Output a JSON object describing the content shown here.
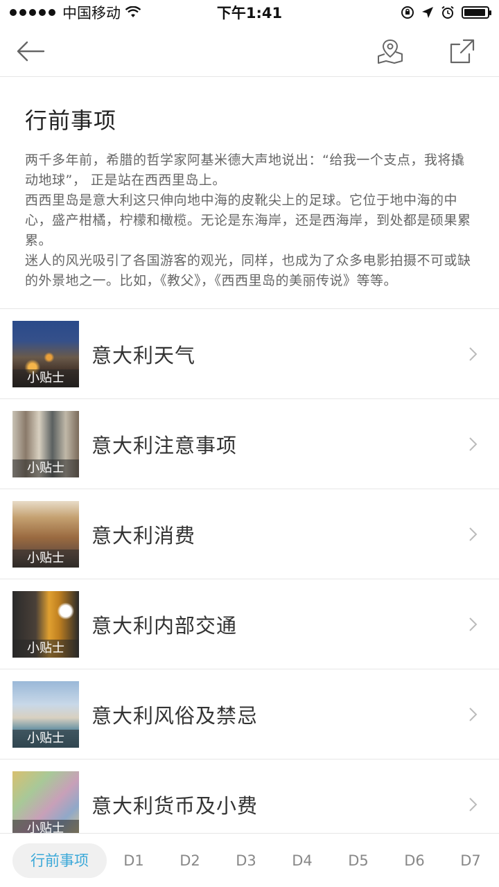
{
  "status_bar": {
    "carrier": "中国移动",
    "time": "下午1:41",
    "battery_level": 0.95
  },
  "nav": {
    "back_icon": "arrow-left-icon",
    "map_icon": "map-pin-icon",
    "share_icon": "share-icon"
  },
  "intro": {
    "title": "行前事项",
    "paragraphs": [
      "两千多年前，希腊的哲学家阿基米德大声地说出：“给我一个支点，我将撬动地球”， 正是站在西西里岛上。",
      "西西里岛是意大利这只伸向地中海的皮靴尖上的足球。它位于地中海的中心，盛产柑橘，柠檬和橄榄。无论是东海岸，还是西海岸，到处都是硕果累累。",
      "迷人的风光吸引了各国游客的观光，同样，也成为了众多电影拍摄不可或缺的外景地之一。比如，《教父》，《西西里岛的美丽传说》等等。"
    ]
  },
  "list": {
    "items": [
      {
        "tag": "小贴士",
        "label": "意大利天气"
      },
      {
        "tag": "小贴士",
        "label": "意大利注意事项"
      },
      {
        "tag": "小贴士",
        "label": "意大利消费"
      },
      {
        "tag": "小贴士",
        "label": "意大利内部交通"
      },
      {
        "tag": "小贴士",
        "label": "意大利风俗及禁忌"
      },
      {
        "tag": "小贴士",
        "label": "意大利货币及小费"
      }
    ]
  },
  "tabs": {
    "items": [
      {
        "label": "行前事项"
      },
      {
        "label": "D1"
      },
      {
        "label": "D2"
      },
      {
        "label": "D3"
      },
      {
        "label": "D4"
      },
      {
        "label": "D5"
      },
      {
        "label": "D6"
      },
      {
        "label": "D7"
      }
    ],
    "active": 0
  },
  "colors": {
    "accent": "#3aa8d8",
    "divider": "#e6e6e6",
    "body_text": "#666666"
  }
}
